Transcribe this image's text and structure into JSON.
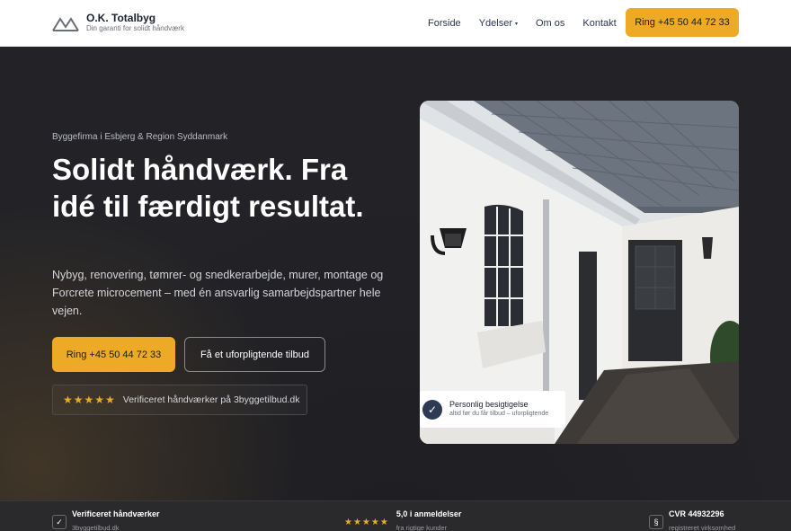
{
  "brand": {
    "name": "O.K. Totalbyg",
    "tagline": "Din garanti for solidt håndværk"
  },
  "nav": {
    "items": [
      {
        "label": "Forside",
        "has_caret": false
      },
      {
        "label": "Ydelser",
        "has_caret": true
      },
      {
        "label": "Om os",
        "has_caret": false
      },
      {
        "label": "Kontakt",
        "has_caret": false
      }
    ],
    "cta": "Ring +45 50 44 72 33",
    "caret": "▾"
  },
  "hero": {
    "kicker": "Byggefirma i Esbjerg & Region Syddanmark",
    "headline": "Solidt håndværk. Fra idé til færdigt resultat.",
    "lead": "Nybyg, renovering, tømrer- og snedkerarbejde, murer, montage og Forcrete microcement – med én ansvarlig samarbejdspartner hele vejen.",
    "primary_button": "Ring +45 50 44 72 33",
    "secondary_button": "Få et uforpligtende tilbud",
    "badge": {
      "stars": "★★★★★",
      "text": "Verificeret håndværker på 3byggetilbud.dk"
    }
  },
  "photo_card": {
    "title": "Personlig besigtigelse",
    "subtitle": "altid før du får tilbud – uforpligtende",
    "icon": "check-icon"
  },
  "trust_bar": {
    "items": [
      {
        "icon": "✓",
        "title": "Verificeret håndværker",
        "subtitle": "3byggetilbud.dk"
      },
      {
        "stars": "★★★★★",
        "title": "5,0 i anmeldelser",
        "subtitle": "fra rigtige kunder"
      },
      {
        "icon": "§",
        "title": "CVR 44932296",
        "subtitle": "registreret virksomhed"
      }
    ]
  },
  "colors": {
    "accent": "#ecaa27",
    "navy": "#2b3550",
    "dark_bg": "#232327"
  }
}
